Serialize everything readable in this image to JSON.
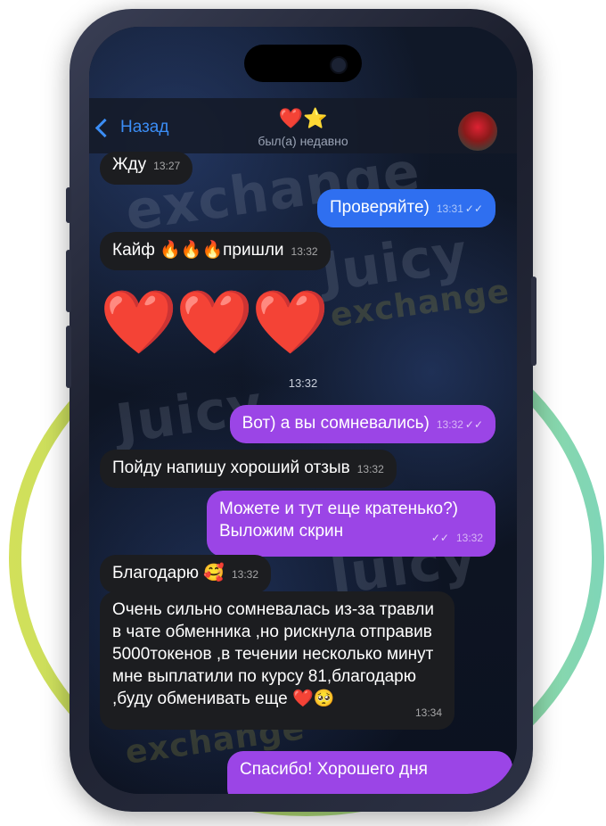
{
  "header": {
    "back_label": "Назад",
    "title_emoji": "❤️⭐",
    "status": "был(а) недавно"
  },
  "watermark": {
    "brand_top": "Juicy",
    "brand_bottom": "exchange"
  },
  "messages": [
    {
      "text": "Жду",
      "time": "13:27"
    },
    {
      "text": "Проверяйте)",
      "time": "13:31",
      "ticks": "✓✓"
    },
    {
      "text": "Кайф 🔥🔥🔥пришли",
      "time": "13:32"
    },
    {
      "text": "❤️❤️❤️",
      "time": "13:32"
    },
    {
      "text": "Вот) а вы сомневались)",
      "time": "13:32",
      "ticks": "✓✓"
    },
    {
      "text": "Пойду напишу хороший отзыв",
      "time": "13:32"
    },
    {
      "text": "Можете и тут еще кратенько?) Выложим скрин",
      "time": "13:32",
      "ticks": "✓✓"
    },
    {
      "text": "Благодарю 🥰",
      "time": "13:32"
    },
    {
      "text": "Очень сильно сомневалась из-за травли в чате обменника ,но рискнула отправив 5000токенов ,в течении несколько минут мне выплатили по курсу 81,благодарю ,буду обменивать еще ❤️🥺",
      "time": "13:34"
    },
    {
      "text": "Спасибо! Хорошего дня"
    }
  ],
  "colors": {
    "accent": "#3b8df5",
    "bubble_incoming": "#1c1d20",
    "bubble_outgoing_blue": "#2f6ff0",
    "bubble_outgoing_purple": "#9b45e6",
    "ring_start": "#d2e05a",
    "ring_end": "#7fd6b8"
  }
}
